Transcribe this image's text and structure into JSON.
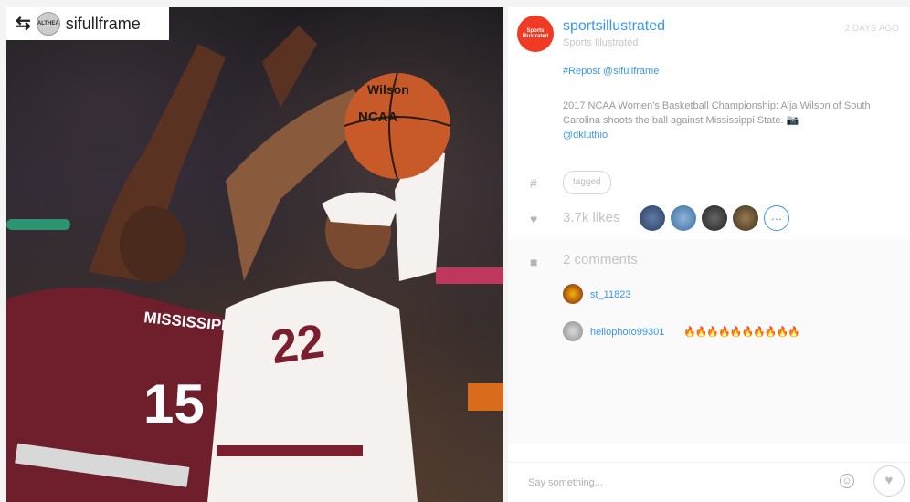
{
  "repost_badge": {
    "icon": "repost-icon",
    "username": "sifullframe",
    "avatar_label": "ALTHEA"
  },
  "photo": {
    "player_front_number": "22",
    "player_back_number": "15",
    "player_back_team": "MISSISSIPPI STATE",
    "ball_brand": "Wilson",
    "ball_logo": "NCAA"
  },
  "post": {
    "avatar_label": "Sports Illustrated",
    "username": "sportsillustrated",
    "fullname": "Sports Illustrated",
    "timestamp": "2 DAYS AGO",
    "caption_tag": "#Repost @sifullframe",
    "caption_body": "2017 NCAA Women's Basketball Championship: A'ja Wilson of South Carolina shoots the ball against Mississippi State. 📷",
    "caption_handle": "@dkluthio",
    "tag_label": "tagged",
    "likes_text": "3.7k likes",
    "more_likers_label": "…",
    "comments_text": "2 comments",
    "comments": [
      {
        "user": "st_11823",
        "text": "",
        "time": ""
      },
      {
        "user": "hellophoto99301",
        "text": "🔥🔥🔥🔥🔥🔥🔥🔥🔥🔥",
        "time": ""
      }
    ],
    "comment_input_placeholder": "Say something...",
    "smile_icon": "smile-icon",
    "heart_icon": "heart-icon"
  },
  "colors": {
    "link_blue": "#3897f0",
    "avatar_red": "#ef3b24"
  }
}
